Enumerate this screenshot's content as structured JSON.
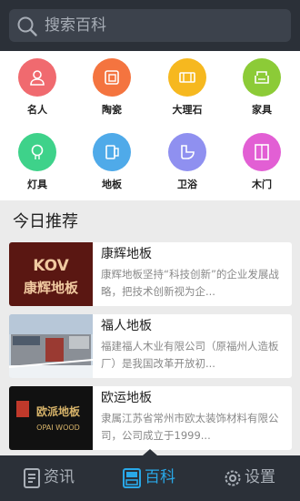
{
  "search": {
    "placeholder": "搜索百科"
  },
  "categories": [
    {
      "label": "名人",
      "icon": "person-icon",
      "color": "#f06a6f"
    },
    {
      "label": "陶瓷",
      "icon": "tile-icon",
      "color": "#f4743f"
    },
    {
      "label": "大理石",
      "icon": "marble-icon",
      "color": "#f6b81f"
    },
    {
      "label": "家具",
      "icon": "sofa-icon",
      "color": "#8ccb37"
    },
    {
      "label": "灯具",
      "icon": "bulb-icon",
      "color": "#3ed28a"
    },
    {
      "label": "地板",
      "icon": "floor-icon",
      "color": "#4faae9"
    },
    {
      "label": "卫浴",
      "icon": "toilet-icon",
      "color": "#8f90f0"
    },
    {
      "label": "木门",
      "icon": "door-icon",
      "color": "#e25fd4"
    }
  ],
  "section": {
    "title": "今日推荐"
  },
  "recommendations": [
    {
      "title": "康辉地板",
      "desc": "康辉地板坚持“科技创新”的企业发展战略，把技术创新视为企...",
      "logo_top": "KOV",
      "logo_bottom": "康辉地板"
    },
    {
      "title": "福人地板",
      "desc": "福建福人木业有限公司（原福州人造板厂）是我国改革开放初...",
      "logo_top": "",
      "logo_bottom": ""
    },
    {
      "title": "欧运地板",
      "desc": "隶属江苏省常州市欧太装饰材料有限公司，公司成立于1999...",
      "logo_top": "欧派地板",
      "logo_bottom": "OPAI WOOD"
    }
  ],
  "tabs": [
    {
      "label": "资讯",
      "icon": "news-icon",
      "active": false
    },
    {
      "label": "百科",
      "icon": "encyclopedia-icon",
      "active": true
    },
    {
      "label": "设置",
      "icon": "gear-icon",
      "active": false
    }
  ],
  "colors": {
    "accent": "#29a8e8",
    "bar": "#2b3038",
    "tab_inactive": "#aab0b8"
  }
}
